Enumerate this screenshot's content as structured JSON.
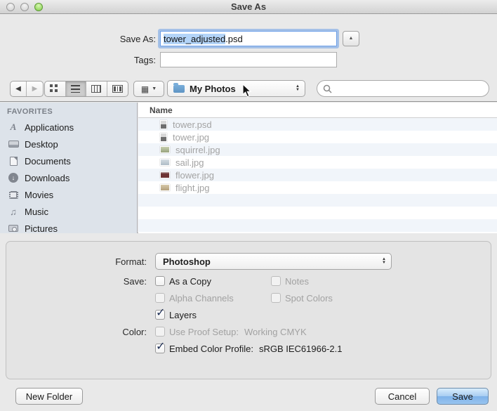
{
  "window": {
    "title": "Save As"
  },
  "form": {
    "save_as_label": "Save As:",
    "filename_selected": "tower_adjusted",
    "filename_extension": ".psd",
    "tags_label": "Tags:",
    "tags_value": ""
  },
  "toolbar": {
    "location_label": "My Photos",
    "search_value": ""
  },
  "icons": {
    "back": "◀",
    "forward": "▶",
    "disclosure_up": "▲",
    "stepper_up": "▲",
    "stepper_down": "▼",
    "arrange_grid": "▦",
    "arrange_caret": "▼",
    "downloads_arrow": "↓",
    "music_note": "♫",
    "applications_glyph": "A",
    "check": "✓"
  },
  "sidebar": {
    "header": "FAVORITES",
    "items": [
      {
        "label": "Applications",
        "icon": "applications-icon"
      },
      {
        "label": "Desktop",
        "icon": "desktop-icon"
      },
      {
        "label": "Documents",
        "icon": "documents-icon"
      },
      {
        "label": "Downloads",
        "icon": "downloads-icon"
      },
      {
        "label": "Movies",
        "icon": "movies-icon"
      },
      {
        "label": "Music",
        "icon": "music-icon"
      },
      {
        "label": "Pictures",
        "icon": "pictures-icon"
      }
    ]
  },
  "file_list": {
    "column_header": "Name",
    "files": [
      {
        "name": "tower.psd",
        "thumb": "portrait-gray"
      },
      {
        "name": "tower.jpg",
        "thumb": "portrait-gray"
      },
      {
        "name": "squirrel.jpg",
        "thumb": "landscape-green"
      },
      {
        "name": "sail.jpg",
        "thumb": "landscape-blue"
      },
      {
        "name": "flower.jpg",
        "thumb": "landscape-red"
      },
      {
        "name": "flight.jpg",
        "thumb": "landscape-tan"
      }
    ]
  },
  "options": {
    "format_label": "Format:",
    "format_value": "Photoshop",
    "save_label": "Save:",
    "color_label": "Color:",
    "as_a_copy": {
      "label": "As a Copy",
      "checked": false,
      "enabled": true
    },
    "notes": {
      "label": "Notes",
      "checked": false,
      "enabled": false
    },
    "alpha_channels": {
      "label": "Alpha Channels",
      "checked": false,
      "enabled": false
    },
    "spot_colors": {
      "label": "Spot Colors",
      "checked": false,
      "enabled": false
    },
    "layers": {
      "label": "Layers",
      "checked": true,
      "enabled": true
    },
    "use_proof_setup": {
      "label": "Use Proof Setup:",
      "value": "Working CMYK",
      "checked": false,
      "enabled": false
    },
    "embed_color_profile": {
      "label": "Embed Color Profile:",
      "value": "sRGB IEC61966-2.1",
      "checked": true,
      "enabled": true
    }
  },
  "footer": {
    "new_folder_label": "New Folder",
    "cancel_label": "Cancel",
    "save_label": "Save"
  },
  "colors": {
    "selection_highlight": "#b3d4f8",
    "focus_ring": "#6b9ee8",
    "sidebar_bg": "#dde3ea",
    "row_stripe": "#f1f5fa",
    "save_button_top": "#d9edfc",
    "save_button_bottom": "#7fb2e9",
    "traffic_green": "#7ecb46",
    "folder_blue": "#6da3d3"
  }
}
